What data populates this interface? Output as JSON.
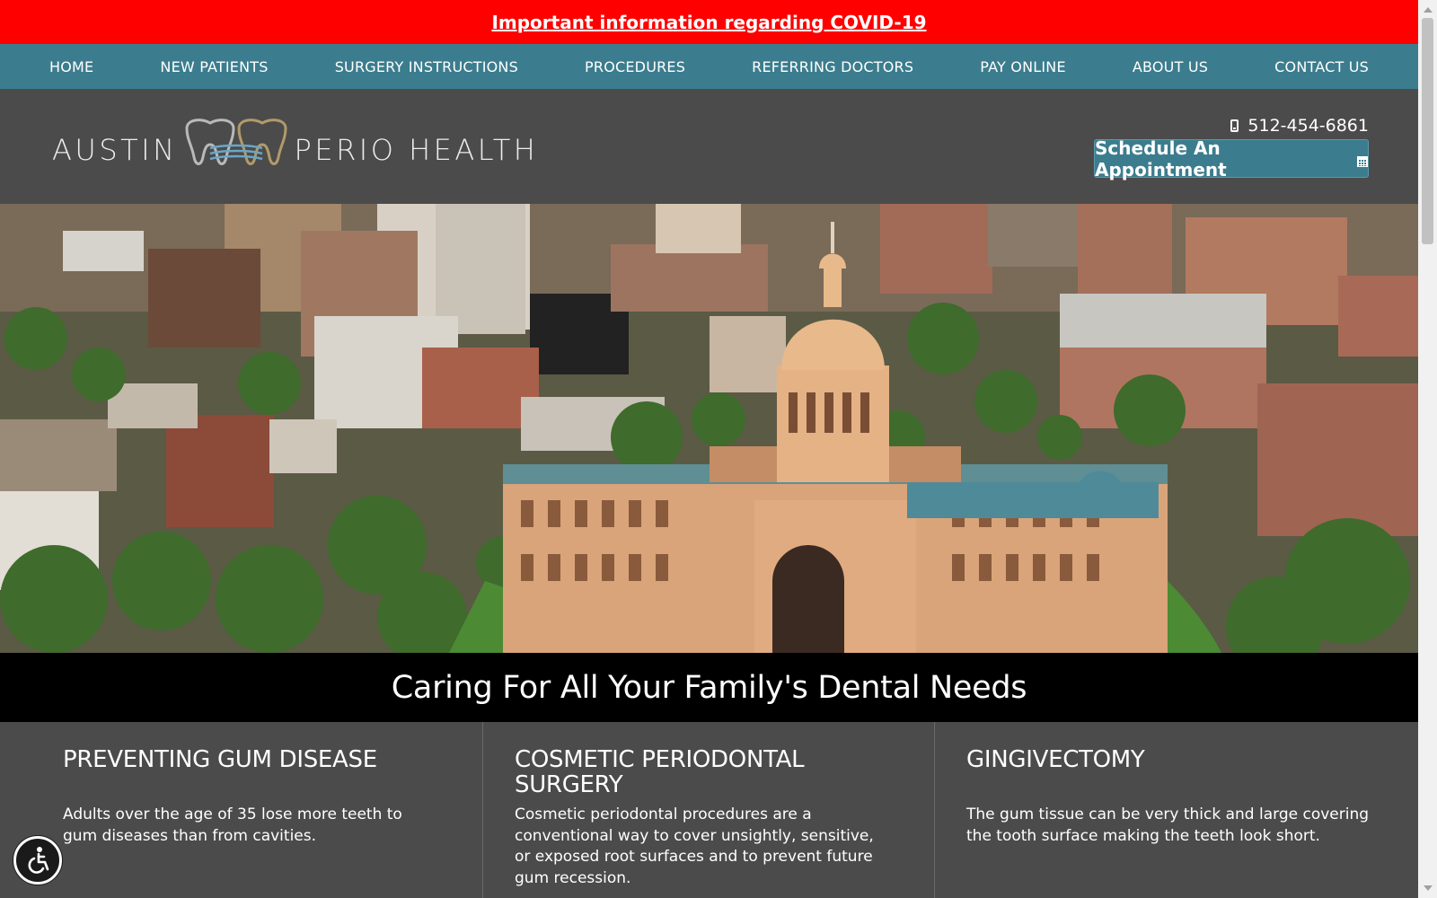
{
  "alert": {
    "text": "Important information regarding COVID-19"
  },
  "nav": {
    "items": [
      {
        "label": "HOME"
      },
      {
        "label": "NEW PATIENTS"
      },
      {
        "label": "SURGERY INSTRUCTIONS"
      },
      {
        "label": "PROCEDURES"
      },
      {
        "label": "REFERRING DOCTORS"
      },
      {
        "label": "PAY ONLINE"
      },
      {
        "label": "ABOUT US"
      },
      {
        "label": "CONTACT US"
      }
    ]
  },
  "header": {
    "logo": {
      "left": "AUSTIN",
      "right": "PERIO HEALTH"
    },
    "phone": "512-454-6861",
    "appointment_label": "Schedule An Appointment"
  },
  "tagline": "Caring For All Your Family's Dental Needs",
  "services": [
    {
      "title": "PREVENTING GUM DISEASE",
      "text": "Adults over the age of 35 lose more teeth to gum diseases than from cavities."
    },
    {
      "title": "COSMETIC PERIODONTAL SURGERY",
      "text": "Cosmetic periodontal procedures are a conventional way to cover unsightly, sensitive, or exposed root surfaces and to prevent future gum recession."
    },
    {
      "title": "GINGIVECTOMY",
      "text": "The gum tissue can be very thick and large covering the tooth surface making the teeth look short."
    }
  ],
  "colors": {
    "alert_bg": "#ff0000",
    "nav_bg": "#3b7d8e",
    "header_bg": "#4b4b4b",
    "tagline_bg": "#000000"
  },
  "icons": {
    "phone": "phone-icon",
    "calendar": "calendar-icon",
    "accessibility": "accessibility-icon"
  }
}
